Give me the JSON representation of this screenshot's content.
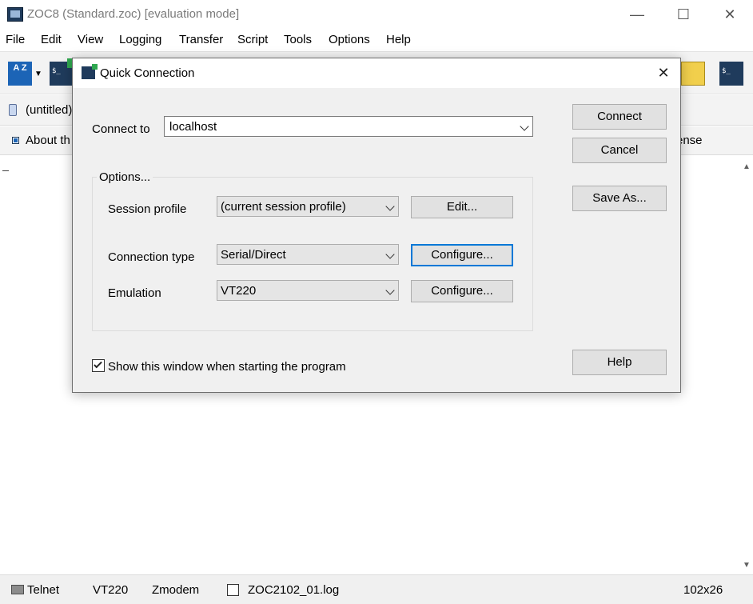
{
  "window": {
    "title": "ZOC8 (Standard.zoc) [evaluation mode]",
    "controls": {
      "minimize": "—",
      "maximize": "☐",
      "close": "✕"
    }
  },
  "menubar": {
    "items": [
      "File",
      "Edit",
      "View",
      "Logging",
      "Transfer",
      "Script",
      "Tools",
      "Options",
      "Help"
    ]
  },
  "toolbar": {
    "az_label": "A Z",
    "icons": [
      "sort-az-icon",
      "dropdown-caret-icon",
      "quick-connect-icon",
      "folder-icon",
      "terminal-icon"
    ]
  },
  "tabs": [
    {
      "label": "(untitled)"
    }
  ],
  "buttonbar": {
    "left_label": "About th",
    "right_label": "ense"
  },
  "statusbar": {
    "protocol": "Telnet",
    "emulation": "VT220",
    "transfer": "Zmodem",
    "logfile": "ZOC2102_01.log",
    "size": "102x26"
  },
  "dialog": {
    "title": "Quick Connection",
    "connect_to_label": "Connect to",
    "connect_to_value": "localhost",
    "options_label": "Options...",
    "session_profile_label": "Session profile",
    "session_profile_value": "(current session profile)",
    "connection_type_label": "Connection type",
    "connection_type_value": "Serial/Direct",
    "emulation_label": "Emulation",
    "emulation_value": "VT220",
    "edit_button": "Edit...",
    "configure_button": "Configure...",
    "configure_button_2": "Configure...",
    "connect_button": "Connect",
    "cancel_button": "Cancel",
    "save_as_button": "Save As...",
    "help_button": "Help",
    "show_window_label": "Show this window when starting the program",
    "show_window_checked": true,
    "close_glyph": "✕"
  }
}
